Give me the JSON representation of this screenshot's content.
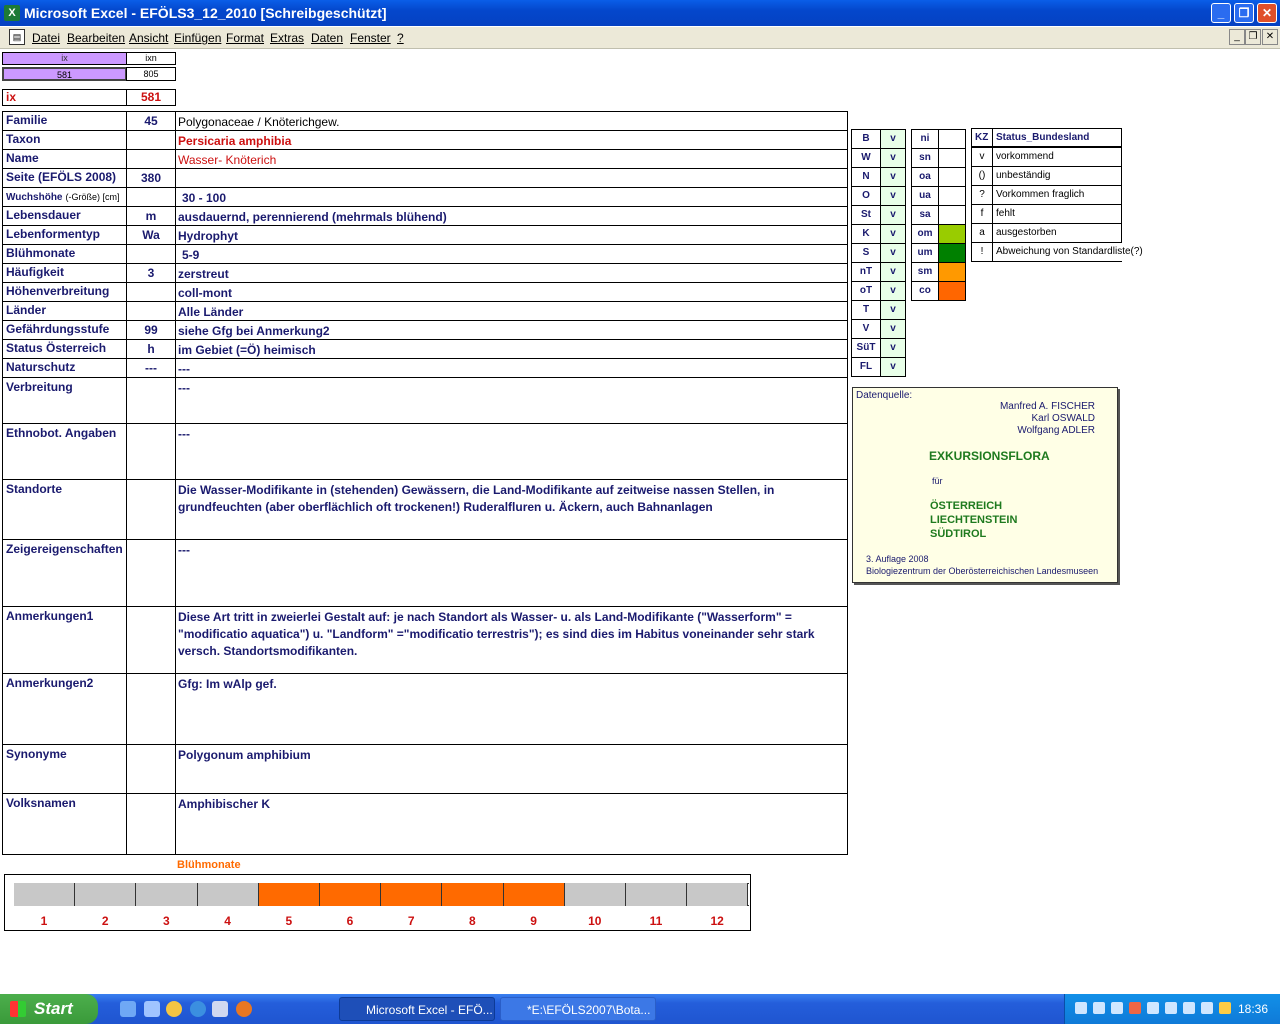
{
  "window": {
    "title": "Microsoft Excel - EFÖLS3_12_2010  [Schreibgeschützt]",
    "app_icon": "excel-icon",
    "buttons": [
      "minimize",
      "maximize",
      "close"
    ]
  },
  "menu": {
    "items": [
      "Datei",
      "Bearbeiten",
      "Ansicht",
      "Einfügen",
      "Format",
      "Extras",
      "Daten",
      "Fenster",
      "?"
    ]
  },
  "top": {
    "ix_header": "ix",
    "ixn_header": "ixn",
    "ix_value": "581",
    "ixn_value": "805",
    "ix_label": "ix",
    "ix_big": "581"
  },
  "rows": [
    {
      "label": "Familie",
      "num": "45",
      "value": "Polygonaceae  /  Knöterichgew."
    },
    {
      "label": "Taxon",
      "num": "",
      "value": "Persicaria amphibia"
    },
    {
      "label": "Name",
      "num": "",
      "value": "Wasser- Knöterich"
    },
    {
      "label": "Seite (EFÖLS 2008)",
      "num": "380",
      "value": ""
    },
    {
      "label": "Wuchshöhe",
      "label_suffix": "(-Größe) [cm]",
      "num": "",
      "value": "30 - 100"
    },
    {
      "label": "Lebensdauer",
      "num": "m",
      "value": "ausdauernd, perennierend (mehrmals blühend)"
    },
    {
      "label": "Lebenformentyp",
      "num": "Wa",
      "value": "Hydrophyt"
    },
    {
      "label": "Blühmonate",
      "num": "",
      "value": "5-9"
    },
    {
      "label": "Häufigkeit",
      "num": "3",
      "value": "zerstreut"
    },
    {
      "label": "Höhenverbreitung",
      "num": "",
      "value": "coll-mont"
    },
    {
      "label": "Länder",
      "num": "",
      "value": "Alle Länder"
    },
    {
      "label": "Gefährdungsstufe",
      "num": "99",
      "value": "siehe Gfg bei Anmerkung2"
    },
    {
      "label": "Status Österreich",
      "num": "h",
      "value": "im Gebiet (=Ö) heimisch"
    },
    {
      "label": "Naturschutz",
      "num": "---",
      "value": "---"
    },
    {
      "label": "Verbreitung",
      "num": "",
      "value": "---"
    },
    {
      "label": "Ethnobot. Angaben",
      "num": "",
      "value": "---"
    },
    {
      "label": "Standorte",
      "num": "",
      "value": "Die Wasser-Modifikante in (stehenden) Gewässern, die Land-Modifikante auf zeitweise nassen Stellen, in grundfeuchten (aber oberflächlich oft trockenen!) Ruderalfluren u. Äckern, auch Bahnanlagen"
    },
    {
      "label": "Zeigereigenschaften",
      "num": "",
      "value": "---"
    },
    {
      "label": "Anmerkungen1",
      "num": "",
      "value": "Diese Art tritt in zweierlei Gestalt auf: je nach Standort als Wasser- u. als Land-Modifikante (\"Wasserform\" = \"modificatio aquatica\") u. \"Landform\" =\"modificatio terrestris\"); es sind dies im Habitus voneinander sehr stark versch. Standortsmodifikanten."
    },
    {
      "label": "Anmerkungen2",
      "num": "",
      "value": "Gfg: Im wAlp gef."
    },
    {
      "label": "Synonyme",
      "num": "",
      "value": "Polygonum amphibium"
    },
    {
      "label": "Volksnamen",
      "num": "",
      "value": "Amphibischer K"
    }
  ],
  "bundeslaender": [
    {
      "code": "B",
      "status": "v"
    },
    {
      "code": "W",
      "status": "v"
    },
    {
      "code": "N",
      "status": "v"
    },
    {
      "code": "O",
      "status": "v"
    },
    {
      "code": "St",
      "status": "v"
    },
    {
      "code": "K",
      "status": "v"
    },
    {
      "code": "S",
      "status": "v"
    },
    {
      "code": "nT",
      "status": "v"
    },
    {
      "code": "oT",
      "status": "v"
    },
    {
      "code": "T",
      "status": "v"
    },
    {
      "code": "V",
      "status": "v"
    },
    {
      "code": "SüT",
      "status": "v"
    },
    {
      "code": "FL",
      "status": "v"
    }
  ],
  "hoehenstufen": [
    {
      "code": "ni",
      "color": ""
    },
    {
      "code": "sn",
      "color": ""
    },
    {
      "code": "oa",
      "color": ""
    },
    {
      "code": "ua",
      "color": ""
    },
    {
      "code": "sa",
      "color": ""
    },
    {
      "code": "om",
      "color": "#99cc00"
    },
    {
      "code": "um",
      "color": "#008000"
    },
    {
      "code": "sm",
      "color": "#ff9900"
    },
    {
      "code": "co",
      "color": "#ff6600"
    }
  ],
  "legend": {
    "kz_header": "KZ",
    "status_header": "Status_Bundesland",
    "items": [
      {
        "kz": "v",
        "text": "vorkommend"
      },
      {
        "kz": "()",
        "text": "unbeständig"
      },
      {
        "kz": "?",
        "text": "Vorkommen fraglich"
      },
      {
        "kz": "f",
        "text": "fehlt"
      },
      {
        "kz": "a",
        "text": "ausgestorben"
      },
      {
        "kz": "!",
        "text": "Abweichung von Standardliste(?)"
      }
    ]
  },
  "source": {
    "label": "Datenquelle:",
    "authors": [
      "Manfred A. FISCHER",
      "Karl OSWALD",
      "Wolfgang ADLER"
    ],
    "title": "EXKURSIONSFLORA",
    "fuer": "für",
    "countries": [
      "ÖSTERREICH",
      "LIECHTENSTEIN",
      "SÜDTIROL"
    ],
    "edition": "3. Auflage 2008",
    "publisher": "Biologiezentrum der Oberösterreichischen Landesmuseen"
  },
  "bloom": {
    "title": "Blühmonate",
    "months": [
      "1",
      "2",
      "3",
      "4",
      "5",
      "6",
      "7",
      "8",
      "9",
      "10",
      "11",
      "12"
    ],
    "active": [
      false,
      false,
      false,
      false,
      true,
      true,
      true,
      true,
      true,
      false,
      false,
      false
    ],
    "active_color": "#ff6a00",
    "inactive_color": "#c8c8c8"
  },
  "taskbar": {
    "start": "Start",
    "tasks": [
      "Microsoft Excel - EFÖ...",
      "*E:\\EFÖLS2007\\Bota..."
    ],
    "clock": "18:36"
  }
}
